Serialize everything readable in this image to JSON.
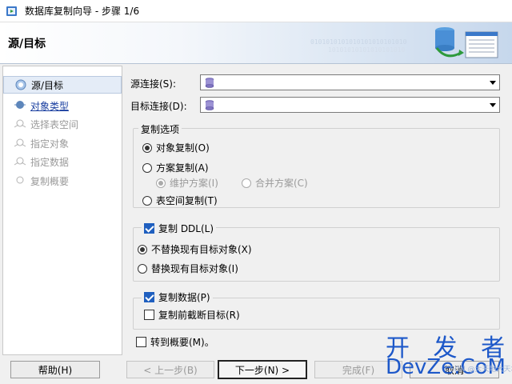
{
  "window": {
    "title": "数据库复制向导 - 步骤 1/6"
  },
  "header": {
    "title": "源/目标",
    "binary_line1": "0101010101010101010101010",
    "binary_line2": "10101010101010101010"
  },
  "sidebar": {
    "steps": [
      {
        "label": "源/目标",
        "state": "active"
      },
      {
        "label": "对象类型",
        "state": "link"
      },
      {
        "label": "选择表空间",
        "state": "disabled"
      },
      {
        "label": "指定对象",
        "state": "disabled"
      },
      {
        "label": "指定数据",
        "state": "disabled"
      },
      {
        "label": "复制概要",
        "state": "disabled"
      }
    ]
  },
  "connections": {
    "source_label": "源连接(S):",
    "source_value": "",
    "target_label": "目标连接(D):",
    "target_value": ""
  },
  "copy_options": {
    "group_title": "复制选项",
    "object_copy": "对象复制(O)",
    "schema_copy": "方案复制(A)",
    "keep_schema": "维护方案(I)",
    "merge_schema": "合并方案(C)",
    "tablespace_copy": "表空间复制(T)",
    "selected": "object_copy"
  },
  "ddl": {
    "checkbox_label": "复制 DDL(L)",
    "checked": true,
    "no_replace": "不替换现有目标对象(X)",
    "replace": "替换现有目标对象(I)",
    "selected": "no_replace"
  },
  "data": {
    "checkbox_label": "复制数据(P)",
    "checked": true,
    "truncate_label": "复制前截断目标(R)",
    "truncate_checked": false
  },
  "goto_summary": {
    "label": "转到概要(M)。",
    "checked": false
  },
  "buttons": {
    "help": "帮助(H)",
    "back": "< 上一步(B)",
    "next": "下一步(N) >",
    "finish": "完成(F)",
    "cancel": "取消"
  },
  "watermark": {
    "top": "开 发 者",
    "bottom": "DevZe.CoM",
    "small": "CSDN @大天地大天地"
  },
  "colors": {
    "accent": "#1f5fbf",
    "link": "#1a3fa0",
    "watermark": "#1d58c9"
  }
}
